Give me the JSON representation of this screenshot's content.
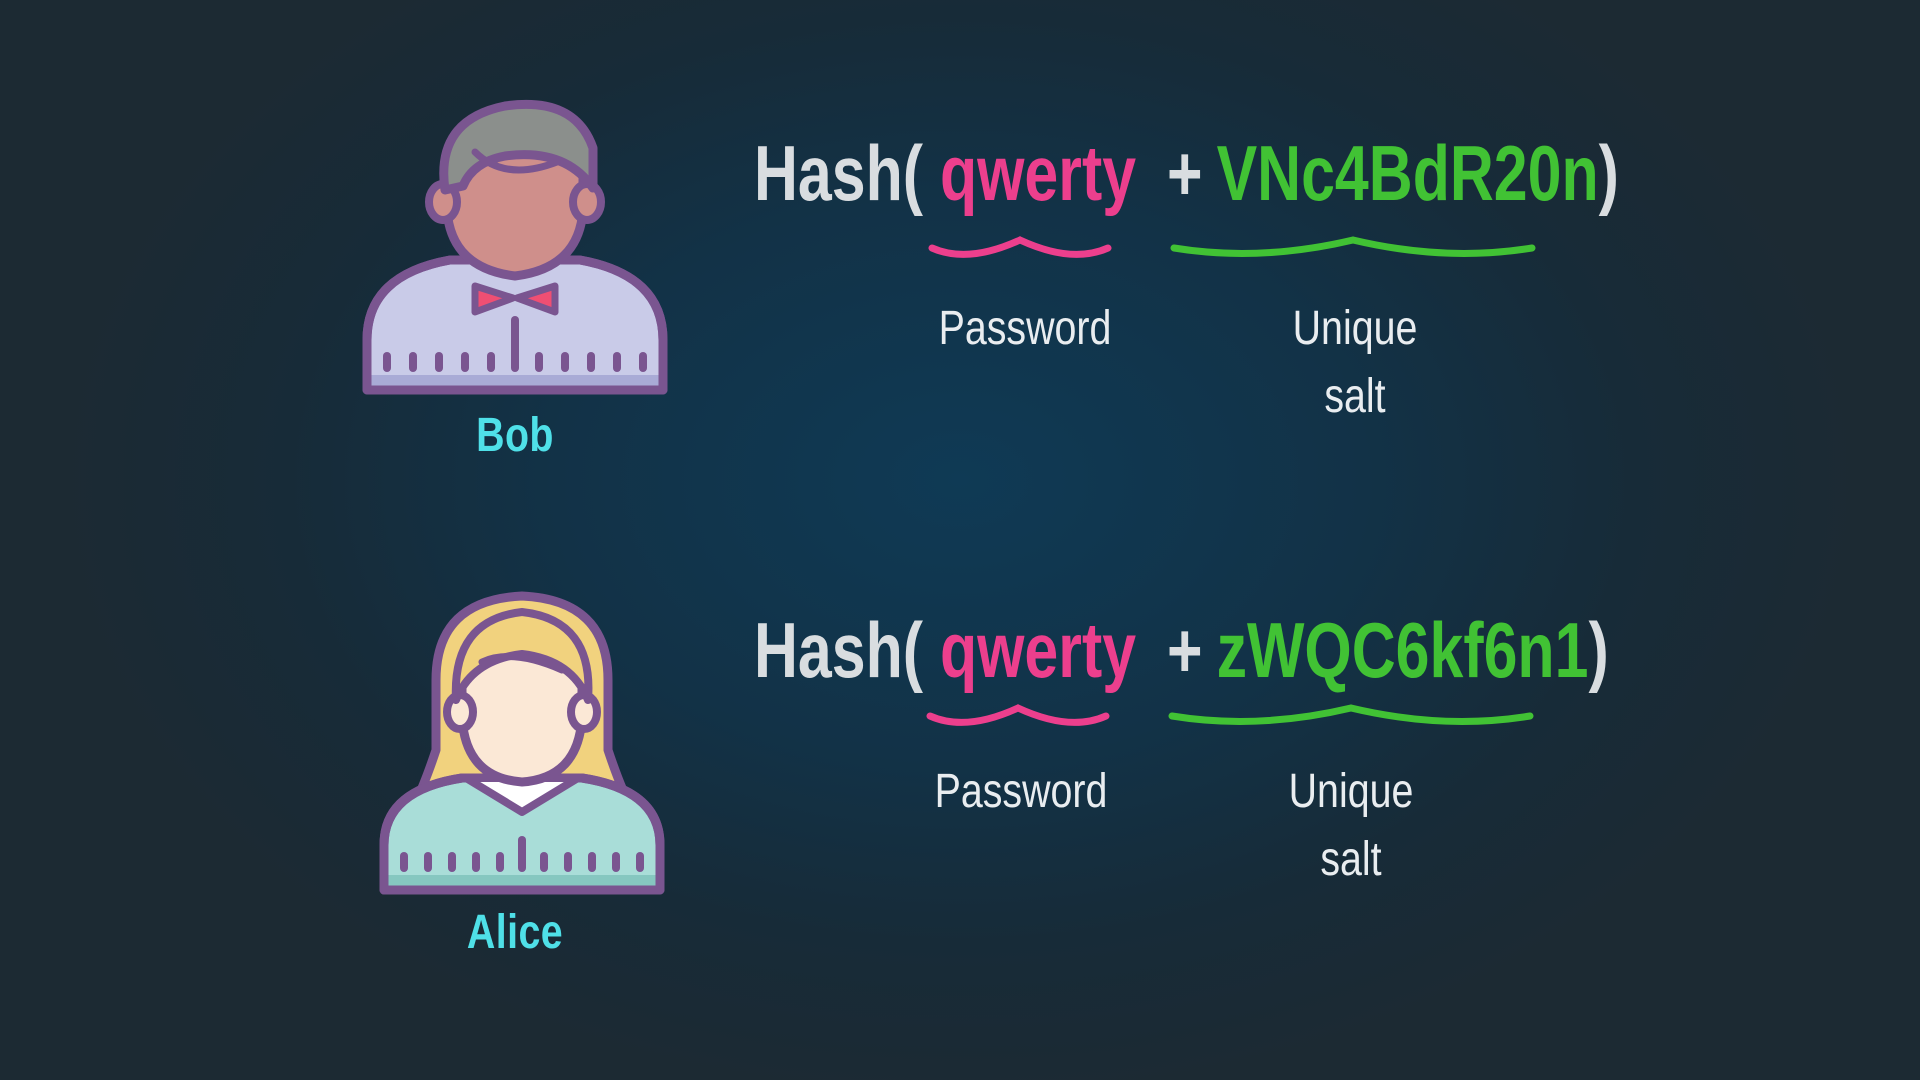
{
  "colors": {
    "background": "#143349",
    "name": "#4fe0e8",
    "hash_text": "#d9dde0",
    "password": "#ec3f8d",
    "salt": "#41c234",
    "label": "#e9edf0"
  },
  "users": [
    {
      "name": "Bob",
      "avatar_icon": "man-user-icon",
      "formula": {
        "hash_open": "Hash(",
        "password": "qwerty",
        "plus": "+",
        "salt": "VNc4BdR20n",
        "close": ")"
      },
      "password_label": "Password",
      "salt_label_line1": "Unique",
      "salt_label_line2": "salt"
    },
    {
      "name": "Alice",
      "avatar_icon": "woman-user-icon",
      "formula": {
        "hash_open": "Hash(",
        "password": "qwerty",
        "plus": "+",
        "salt": "zWQC6kf6n1",
        "close": ")"
      },
      "password_label": "Password",
      "salt_label_line1": "Unique",
      "salt_label_line2": "salt"
    }
  ]
}
